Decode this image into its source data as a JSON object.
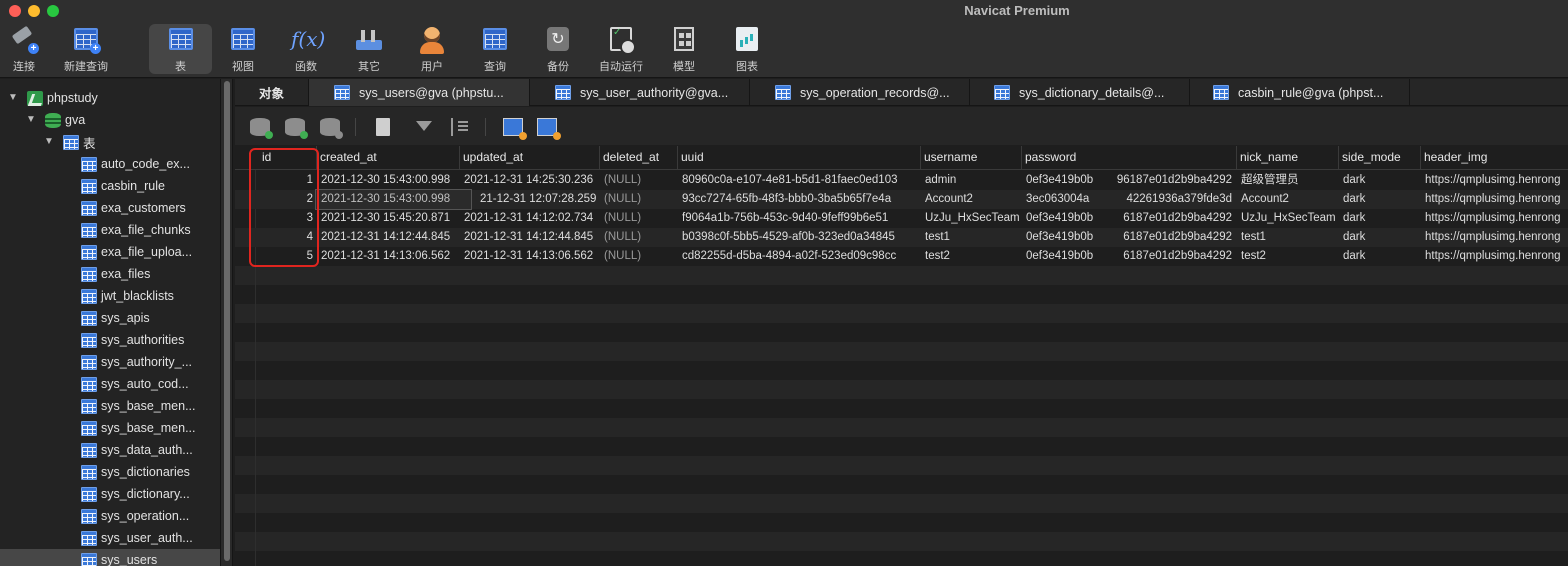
{
  "window": {
    "title": "Navicat Premium"
  },
  "toolbar": {
    "items": [
      {
        "label": "连接",
        "icon": "connection-icon"
      },
      {
        "label": "新建查询",
        "icon": "new-query-icon"
      },
      {
        "label": "表",
        "icon": "table-icon",
        "active": true
      },
      {
        "label": "视图",
        "icon": "view-icon"
      },
      {
        "label": "函数",
        "icon": "function-icon"
      },
      {
        "label": "其它",
        "icon": "other-icon"
      },
      {
        "label": "用户",
        "icon": "user-icon"
      },
      {
        "label": "查询",
        "icon": "query-icon"
      },
      {
        "label": "备份",
        "icon": "backup-icon"
      },
      {
        "label": "自动运行",
        "icon": "automation-icon"
      },
      {
        "label": "模型",
        "icon": "model-icon"
      },
      {
        "label": "图表",
        "icon": "chart-icon"
      }
    ]
  },
  "sidebar": {
    "connection": "phpstudy",
    "database": "gva",
    "group": "表",
    "tables": [
      "auto_code_ex...",
      "casbin_rule",
      "exa_customers",
      "exa_file_chunks",
      "exa_file_uploa...",
      "exa_files",
      "jwt_blacklists",
      "sys_apis",
      "sys_authorities",
      "sys_authority_...",
      "sys_auto_cod...",
      "sys_base_men...",
      "sys_base_men...",
      "sys_data_auth...",
      "sys_dictionaries",
      "sys_dictionary...",
      "sys_operation...",
      "sys_user_auth...",
      "sys_users"
    ],
    "selected": "sys_users"
  },
  "tabs": {
    "objects": "对象",
    "items": [
      "sys_users@gva (phpstu...",
      "sys_user_authority@gva...",
      "sys_operation_records@...",
      "sys_dictionary_details@...",
      "casbin_rule@gva (phpst..."
    ]
  },
  "grid": {
    "columns": [
      "id",
      "created_at",
      "updated_at",
      "deleted_at",
      "uuid",
      "username",
      "password",
      "nick_name",
      "side_mode",
      "header_img"
    ],
    "rows": [
      [
        "1",
        "2021-12-30 15:43:00.998",
        "2021-12-31 14:25:30.236",
        "(NULL)",
        "80960c0a-e107-4e81-b5d1-81faec0ed103",
        "admin",
        "0ef3e419b0b",
        "96187e01d2b9ba4292",
        "超级管理员",
        "dark",
        "https://qmplusimg.henrong"
      ],
      [
        "2",
        "2021-12-30 15:43:00.998",
        "21-12-31 12:07:28.259",
        "(NULL)",
        "93cc7274-65fb-48f3-bbb0-3ba5b65f7e4a",
        "Account2",
        "3ec063004a",
        "42261936a379fde3d",
        "Account2",
        "dark",
        "https://qmplusimg.henrong"
      ],
      [
        "3",
        "2021-12-30 15:45:20.871",
        "2021-12-31 14:12:02.734",
        "(NULL)",
        "f9064a1b-756b-453c-9d40-9feff99b6e51",
        "UzJu_HxSecTeam",
        "0ef3e419b0b",
        "6187e01d2b9ba4292",
        "UzJu_HxSecTeam",
        "dark",
        "https://qmplusimg.henrong"
      ],
      [
        "4",
        "2021-12-31 14:12:44.845",
        "2021-12-31 14:12:44.845",
        "(NULL)",
        "b0398c0f-5bb5-4529-af0b-323ed0a34845",
        "test1",
        "0ef3e419b0b",
        "6187e01d2b9ba4292",
        "test1",
        "dark",
        "https://qmplusimg.henrong"
      ],
      [
        "5",
        "2021-12-31 14:13:06.562",
        "2021-12-31 14:13:06.562",
        "(NULL)",
        "cd82255d-d5ba-4894-a02f-523ed09c98cc",
        "test2",
        "0ef3e419b0b",
        "6187e01d2b9ba4292",
        "test2",
        "dark",
        "https://qmplusimg.henrong"
      ]
    ]
  },
  "colors": {
    "highlight": "#e0251f",
    "accent": "#3a78d8"
  }
}
